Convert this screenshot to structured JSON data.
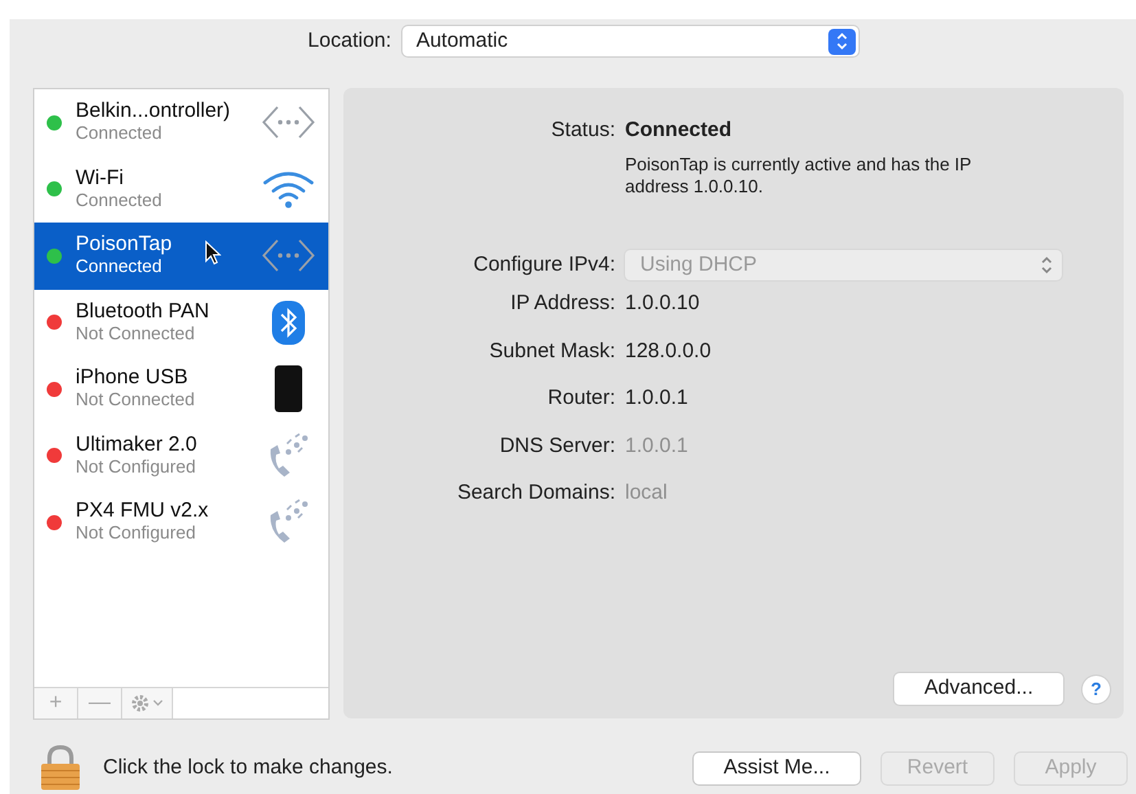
{
  "location": {
    "label": "Location:",
    "value": "Automatic"
  },
  "services": [
    {
      "name": "Belkin...ontroller)",
      "status": "Connected",
      "color": "#2ec04a",
      "kind": "ethernet",
      "selected": false
    },
    {
      "name": "Wi-Fi",
      "status": "Connected",
      "color": "#2ec04a",
      "kind": "wifi",
      "selected": false
    },
    {
      "name": "PoisonTap",
      "status": "Connected",
      "color": "#2ec04a",
      "kind": "ethernet",
      "selected": true
    },
    {
      "name": "Bluetooth PAN",
      "status": "Not Connected",
      "color": "#f03a3a",
      "kind": "bluetooth",
      "selected": false
    },
    {
      "name": "iPhone USB",
      "status": "Not Connected",
      "color": "#f03a3a",
      "kind": "iphone",
      "selected": false
    },
    {
      "name": "Ultimaker 2.0",
      "status": "Not Configured",
      "color": "#f03a3a",
      "kind": "modem",
      "selected": false
    },
    {
      "name": "PX4 FMU v2.x",
      "status": "Not Configured",
      "color": "#f03a3a",
      "kind": "modem",
      "selected": false
    }
  ],
  "list_buttons": [
    "+",
    "—"
  ],
  "status": {
    "label": "Status:",
    "value": "Connected",
    "description": "PoisonTap is currently active and has the IP address 1.0.0.10."
  },
  "configure": {
    "label": "Configure IPv4:",
    "value": "Using DHCP",
    "disabled": true
  },
  "details": [
    {
      "label": "IP Address:",
      "value": "1.0.0.10",
      "dimmed": false
    },
    {
      "label": "Subnet Mask:",
      "value": "128.0.0.0",
      "dimmed": false
    },
    {
      "label": "Router:",
      "value": "1.0.0.1",
      "dimmed": false
    },
    {
      "label": "DNS Server:",
      "value": "1.0.0.1",
      "dimmed": true
    },
    {
      "label": "Search Domains:",
      "value": "local",
      "dimmed": true
    }
  ],
  "advanced_button": "Advanced...",
  "help_button": "?",
  "lock_text": "Click the lock to make changes.",
  "footer_buttons": [
    {
      "label": "Assist Me...",
      "disabled": false
    },
    {
      "label": "Revert",
      "disabled": true
    },
    {
      "label": "Apply",
      "disabled": true
    }
  ]
}
